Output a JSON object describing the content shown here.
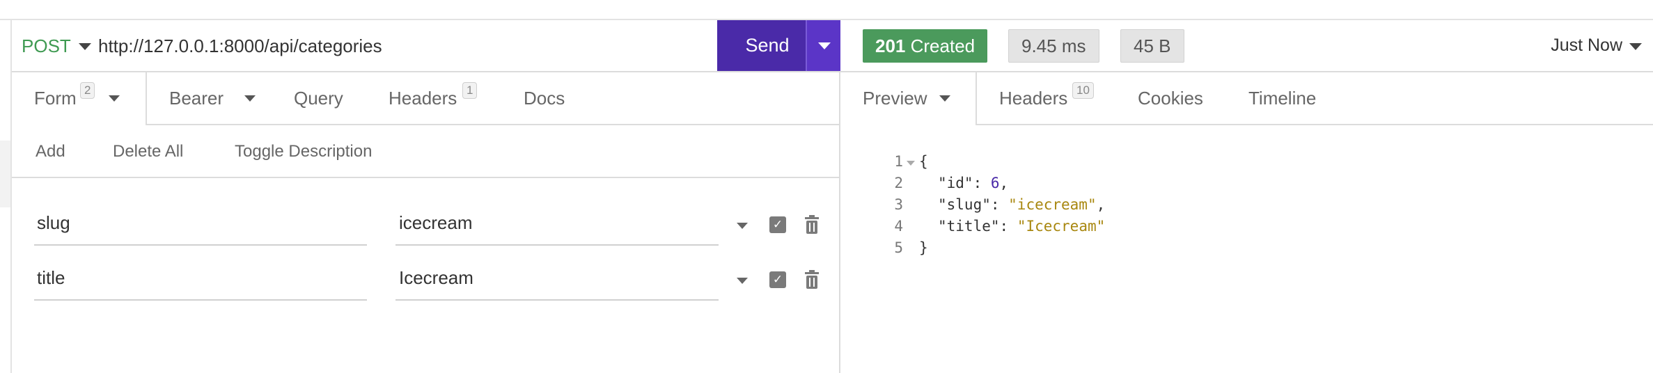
{
  "request": {
    "method": "POST",
    "url": "http://127.0.0.1:8000/api/categories",
    "send_label": "Send",
    "tabs": [
      {
        "label": "Form",
        "badge": "2"
      },
      {
        "label": "Bearer"
      },
      {
        "label": "Query"
      },
      {
        "label": "Headers",
        "badge": "1"
      },
      {
        "label": "Docs"
      }
    ],
    "actions": [
      "Add",
      "Delete All",
      "Toggle Description"
    ],
    "params": [
      {
        "key": "slug",
        "value": "icecream",
        "enabled": true
      },
      {
        "key": "title",
        "value": "Icecream",
        "enabled": true
      }
    ]
  },
  "response": {
    "status": {
      "code": "201",
      "text": "Created",
      "color": "#4b9a5c"
    },
    "time": "9.45 ms",
    "size": "45 B",
    "history": "Just Now",
    "tabs": [
      {
        "label": "Preview"
      },
      {
        "label": "Headers",
        "badge": "10"
      },
      {
        "label": "Cookies"
      },
      {
        "label": "Timeline"
      }
    ],
    "body_lines": [
      {
        "n": "1",
        "text": "{"
      },
      {
        "n": "2",
        "key": "\"id\"",
        "num": "6",
        "suffix": ","
      },
      {
        "n": "3",
        "key": "\"slug\"",
        "str": "\"icecream\"",
        "suffix": ","
      },
      {
        "n": "4",
        "key": "\"title\"",
        "str": "\"Icecream\"",
        "suffix": ""
      },
      {
        "n": "5",
        "text": "}"
      }
    ]
  },
  "colors": {
    "accent": "#4a2aa8",
    "method": "#3f9a52",
    "status": "#4b9a5c"
  }
}
